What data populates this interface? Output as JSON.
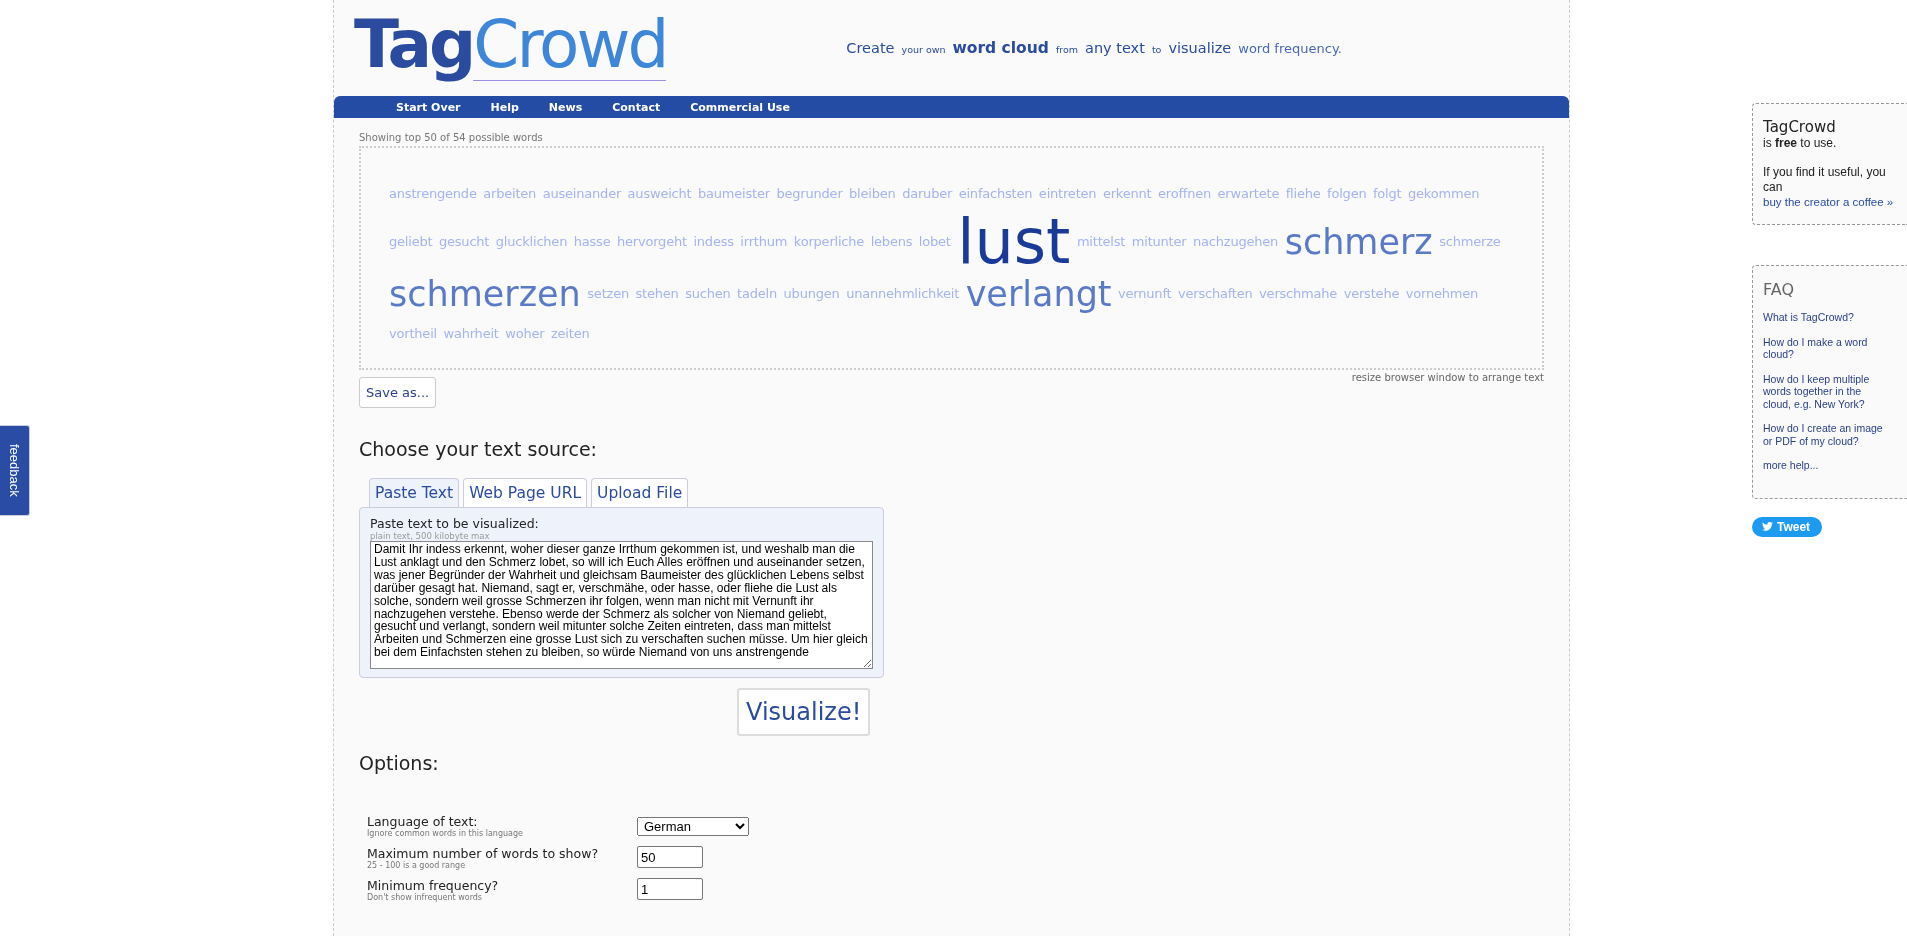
{
  "logo": {
    "part_1": "Tag",
    "part_2": "Crowd"
  },
  "tagline": [
    {
      "text": "Create",
      "kind": "medium"
    },
    {
      "text": "your own",
      "kind": "small"
    },
    {
      "text": "word cloud",
      "kind": "strong"
    },
    {
      "text": "from",
      "kind": "small"
    },
    {
      "text": "any text",
      "kind": "medium"
    },
    {
      "text": "to",
      "kind": "small"
    },
    {
      "text": "visualize",
      "kind": "medium"
    },
    {
      "text": "word frequency.",
      "kind": "normal"
    }
  ],
  "nav": [
    "Start Over",
    "Help",
    "News",
    "Contact",
    "Commercial Use"
  ],
  "cloud": {
    "caption": "Showing top 50 of 54 possible words",
    "note": "resize browser window to arrange text",
    "save_button": "Save as...",
    "words": [
      {
        "text": "anstrengende",
        "kind": "small"
      },
      {
        "text": "arbeiten",
        "kind": "small"
      },
      {
        "text": "auseinander",
        "kind": "small"
      },
      {
        "text": "ausweicht",
        "kind": "small"
      },
      {
        "text": "baumeister",
        "kind": "small"
      },
      {
        "text": "begrunder",
        "kind": "small"
      },
      {
        "text": "bleiben",
        "kind": "small"
      },
      {
        "text": "daruber",
        "kind": "small"
      },
      {
        "text": "einfachsten",
        "kind": "small"
      },
      {
        "text": "eintreten",
        "kind": "small"
      },
      {
        "text": "erkennt",
        "kind": "small"
      },
      {
        "text": "eroffnen",
        "kind": "small"
      },
      {
        "text": "erwartete",
        "kind": "small"
      },
      {
        "text": "fliehe",
        "kind": "small"
      },
      {
        "text": "folgen",
        "kind": "small"
      },
      {
        "text": "folgt",
        "kind": "small"
      },
      {
        "text": "gekommen",
        "kind": "small"
      },
      {
        "text": "geliebt",
        "kind": "small"
      },
      {
        "text": "gesucht",
        "kind": "small"
      },
      {
        "text": "glucklichen",
        "kind": "small"
      },
      {
        "text": "hasse",
        "kind": "small"
      },
      {
        "text": "hervorgeht",
        "kind": "small"
      },
      {
        "text": "indess",
        "kind": "small"
      },
      {
        "text": "irrthum",
        "kind": "small"
      },
      {
        "text": "korperliche",
        "kind": "small"
      },
      {
        "text": "lebens",
        "kind": "small"
      },
      {
        "text": "lobet",
        "kind": "small"
      },
      {
        "text": "lust",
        "kind": "largest"
      },
      {
        "text": "mittelst",
        "kind": "small"
      },
      {
        "text": "mitunter",
        "kind": "small"
      },
      {
        "text": "nachzugehen",
        "kind": "small"
      },
      {
        "text": "schmerz",
        "kind": "large"
      },
      {
        "text": "schmerze",
        "kind": "small"
      },
      {
        "text": "schmerzen",
        "kind": "large"
      },
      {
        "text": "setzen",
        "kind": "small"
      },
      {
        "text": "stehen",
        "kind": "small"
      },
      {
        "text": "suchen",
        "kind": "small"
      },
      {
        "text": "tadeln",
        "kind": "small"
      },
      {
        "text": "ubungen",
        "kind": "small"
      },
      {
        "text": "unannehmlichkeit",
        "kind": "small"
      },
      {
        "text": "verlangt",
        "kind": "large"
      },
      {
        "text": "vernunft",
        "kind": "small"
      },
      {
        "text": "verschaften",
        "kind": "small"
      },
      {
        "text": "verschmahe",
        "kind": "small"
      },
      {
        "text": "verstehe",
        "kind": "small"
      },
      {
        "text": "vornehmen",
        "kind": "small"
      },
      {
        "text": "vortheil",
        "kind": "small"
      },
      {
        "text": "wahrheit",
        "kind": "small"
      },
      {
        "text": "woher",
        "kind": "small"
      },
      {
        "text": "zeiten",
        "kind": "small"
      }
    ]
  },
  "source": {
    "heading": "Choose your text source:",
    "tabs": [
      {
        "label": "Paste Text",
        "selected": true
      },
      {
        "label": "Web Page URL",
        "selected": false
      },
      {
        "label": "Upload File",
        "selected": false
      }
    ],
    "field_label": "Paste text to be visualized:",
    "field_hint": "plain text, 500 kilobyte max",
    "text": "Damit Ihr indess erkennt, woher dieser ganze Irrthum gekommen ist, und weshalb man die Lust anklagt und den Schmerz lobet, so will ich Euch Alles eröffnen und auseinander setzen, was jener Begründer der Wahrheit und gleichsam Baumeister des glücklichen Lebens selbst darüber gesagt hat. Niemand, sagt er, verschmähe, oder hasse, oder fliehe die Lust als solche, sondern weil grosse Schmerzen ihr folgen, wenn man nicht mit Vernunft ihr nachzugehen verstehe. Ebenso werde der Schmerz als solcher von Niemand geliebt, gesucht und verlangt, sondern weil mitunter solche Zeiten eintreten, dass man mittelst Arbeiten und Schmerzen eine grosse Lust sich zu verschaften suchen müsse. Um hier gleich bei dem Einfachsten stehen zu bleiben, so würde Niemand von uns anstrengende",
    "submit": "Visualize!"
  },
  "options": {
    "heading": "Options:",
    "rows": [
      {
        "kind": "select",
        "label": "Language of text:",
        "hint": "Ignore common words in this language",
        "value": "German"
      },
      {
        "kind": "input",
        "label": "Maximum number of words to show?",
        "hint": "25 - 100 is a good range",
        "value": "50"
      },
      {
        "kind": "input",
        "label": "Minimum frequency?",
        "hint": "Don't show infrequent words",
        "value": "1"
      }
    ]
  },
  "sidebar": {
    "promo": {
      "title": "TagCrowd",
      "line_1": "is **free** to use.",
      "line_2": "If you find it useful, you can",
      "link": "buy the creator a coffee »"
    },
    "faq": {
      "title": "FAQ",
      "links": [
        "What is TagCrowd?",
        "How do I make a word cloud?",
        "How do I keep multiple words together in the cloud, e.g. New York?",
        "How do I create an image or PDF of my cloud?",
        "more help..."
      ]
    },
    "tweet": "Tweet"
  },
  "feedback": "feedback"
}
